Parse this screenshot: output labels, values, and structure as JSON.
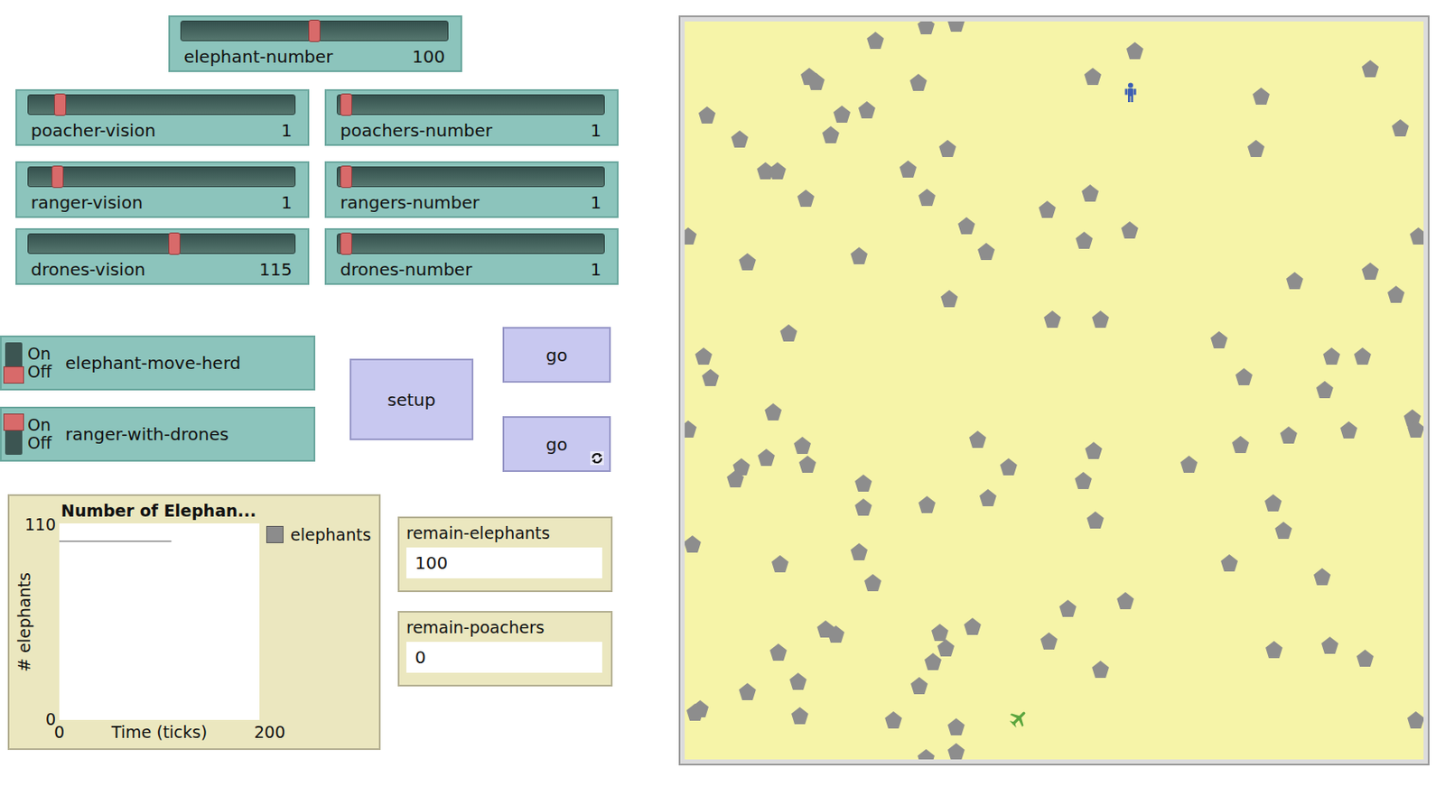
{
  "sliders": [
    {
      "label": "elephant-number",
      "value": "100",
      "level": 0.5
    },
    {
      "label": "poacher-vision",
      "value": "1",
      "level": 0.1
    },
    {
      "label": "poachers-number",
      "value": "1",
      "level": 0.01
    },
    {
      "label": "ranger-vision",
      "value": "1",
      "level": 0.09
    },
    {
      "label": "rangers-number",
      "value": "1",
      "level": 0.01
    },
    {
      "label": "drones-vision",
      "value": "115",
      "level": 0.55
    },
    {
      "label": "drones-number",
      "value": "1",
      "level": 0.01
    }
  ],
  "switches": [
    {
      "label": "elephant-move-herd",
      "on_text": "On",
      "off_text": "Off",
      "on": false
    },
    {
      "label": "ranger-with-drones",
      "on_text": "On",
      "off_text": "Off",
      "on": true
    }
  ],
  "buttons": [
    {
      "label": "setup",
      "forever": false
    },
    {
      "label": "go",
      "forever": false
    },
    {
      "label": "go",
      "forever": true
    }
  ],
  "plot": {
    "title": "Number of Elephan...",
    "y_label": "# elephants",
    "x_label": "Time (ticks)",
    "y_max": "110",
    "y_min": "0",
    "x_min": "0",
    "x_max": "200",
    "series": [
      {
        "name": "elephants",
        "color": "#8c8c8c",
        "ticks": [
          0,
          10,
          20,
          30,
          40,
          50,
          60,
          70,
          80,
          90,
          100,
          110,
          112
        ],
        "values": [
          100,
          100,
          100,
          100,
          100,
          100,
          100,
          100,
          100,
          100,
          100,
          100,
          100
        ]
      }
    ]
  },
  "monitors": [
    {
      "label": "remain-elephants",
      "value": "100"
    },
    {
      "label": "remain-poachers",
      "value": "0"
    }
  ],
  "world": {
    "elephants": [
      [
        25.8,
        2.6
      ],
      [
        32.7,
        0.6
      ],
      [
        36.7,
        0.2
      ],
      [
        60.9,
        4.0
      ],
      [
        92.8,
        6.4
      ],
      [
        16.9,
        7.4
      ],
      [
        17.8,
        8.1
      ],
      [
        31.6,
        8.2
      ],
      [
        55.2,
        7.4
      ],
      [
        78.0,
        10.1
      ],
      [
        3.0,
        12.7
      ],
      [
        21.3,
        12.6
      ],
      [
        24.7,
        12.0
      ],
      [
        7.4,
        15.9
      ],
      [
        19.8,
        15.4
      ],
      [
        35.6,
        17.2
      ],
      [
        96.9,
        14.4
      ],
      [
        77.3,
        17.2
      ],
      [
        10.9,
        20.2
      ],
      [
        12.5,
        20.2
      ],
      [
        30.2,
        20.0
      ],
      [
        16.4,
        24.0
      ],
      [
        32.8,
        23.8
      ],
      [
        54.9,
        23.2
      ],
      [
        49.1,
        25.5
      ],
      [
        38.1,
        27.7
      ],
      [
        54.1,
        29.6
      ],
      [
        60.2,
        28.3
      ],
      [
        0.5,
        29.1
      ],
      [
        99.3,
        29.1
      ],
      [
        40.8,
        31.2
      ],
      [
        23.6,
        31.8
      ],
      [
        8.5,
        32.5
      ],
      [
        82.5,
        35.1
      ],
      [
        92.8,
        33.8
      ],
      [
        96.3,
        37.0
      ],
      [
        35.8,
        37.5
      ],
      [
        49.8,
        40.4
      ],
      [
        56.3,
        40.4
      ],
      [
        14.1,
        42.2
      ],
      [
        72.3,
        43.1
      ],
      [
        2.6,
        45.3
      ],
      [
        3.5,
        48.3
      ],
      [
        87.5,
        45.3
      ],
      [
        91.8,
        45.3
      ],
      [
        75.7,
        48.1
      ],
      [
        86.6,
        49.9
      ],
      [
        12.0,
        52.9
      ],
      [
        0.5,
        55.2
      ],
      [
        98.5,
        53.7
      ],
      [
        98.9,
        55.2
      ],
      [
        89.9,
        55.4
      ],
      [
        81.8,
        56.1
      ],
      [
        75.2,
        57.3
      ],
      [
        39.7,
        56.6
      ],
      [
        55.4,
        58.1
      ],
      [
        68.2,
        60.0
      ],
      [
        15.9,
        57.4
      ],
      [
        16.6,
        60.0
      ],
      [
        11.1,
        59.1
      ],
      [
        7.7,
        60.4
      ],
      [
        6.9,
        62.0
      ],
      [
        43.8,
        60.3
      ],
      [
        24.2,
        62.5
      ],
      [
        24.2,
        65.8
      ],
      [
        53.9,
        62.2
      ],
      [
        41.0,
        64.5
      ],
      [
        32.8,
        65.5
      ],
      [
        79.7,
        65.2
      ],
      [
        55.6,
        67.5
      ],
      [
        81.1,
        69.0
      ],
      [
        1.0,
        70.8
      ],
      [
        23.6,
        71.9
      ],
      [
        12.9,
        73.5
      ],
      [
        25.5,
        76.0
      ],
      [
        73.7,
        73.4
      ],
      [
        86.3,
        75.2
      ],
      [
        59.7,
        78.5
      ],
      [
        51.9,
        79.5
      ],
      [
        38.9,
        82.0
      ],
      [
        19.1,
        82.3
      ],
      [
        20.5,
        83.0
      ],
      [
        34.5,
        82.8
      ],
      [
        35.3,
        84.9
      ],
      [
        33.6,
        86.8
      ],
      [
        49.3,
        84.0
      ],
      [
        79.8,
        85.1
      ],
      [
        87.3,
        84.5
      ],
      [
        92.1,
        86.3
      ],
      [
        12.7,
        85.5
      ],
      [
        15.4,
        89.4
      ],
      [
        31.8,
        90.0
      ],
      [
        56.3,
        87.8
      ],
      [
        8.5,
        90.8
      ],
      [
        2.1,
        93.1
      ],
      [
        1.4,
        93.6
      ],
      [
        15.6,
        94.1
      ],
      [
        28.2,
        94.6
      ],
      [
        36.7,
        95.6
      ],
      [
        36.7,
        99.0
      ],
      [
        32.7,
        99.8
      ],
      [
        99.0,
        94.6
      ]
    ],
    "rangers": [
      [
        60.4,
        9.6
      ]
    ],
    "drones": [
      [
        45.2,
        94.4
      ]
    ],
    "poachers": []
  }
}
